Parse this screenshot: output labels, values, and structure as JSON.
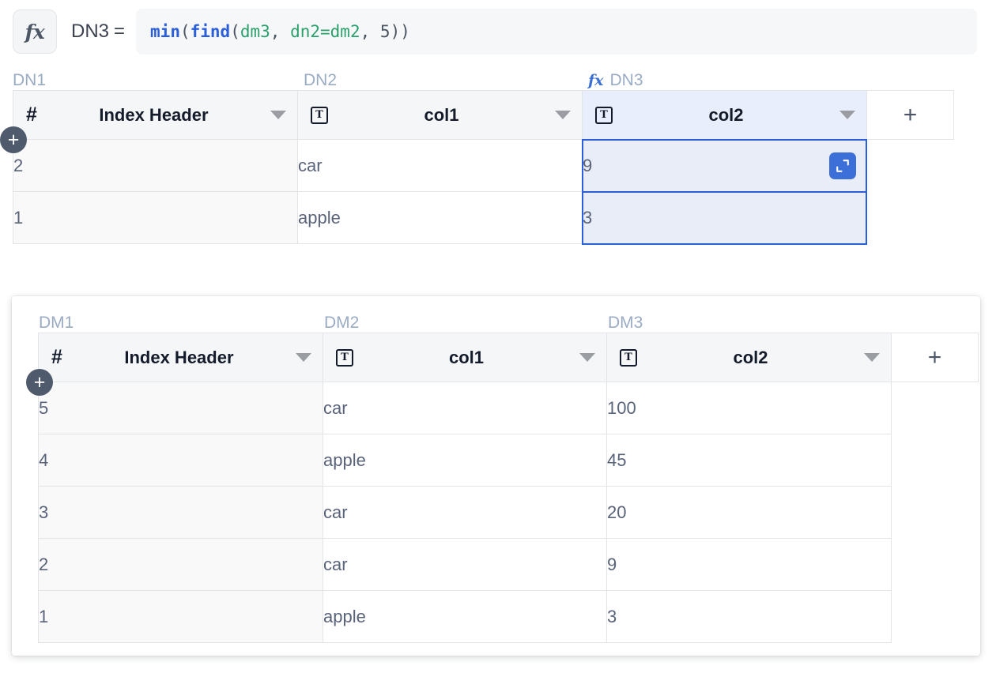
{
  "formula_bar": {
    "fx_icon": "fx-icon",
    "target_name": "DN3",
    "equals": "=",
    "formula_raw": "min(find(dm3, dn2=dm2, 5))",
    "tokens": [
      {
        "text": "min",
        "kind": "fn"
      },
      {
        "text": "(",
        "kind": "punct"
      },
      {
        "text": "find",
        "kind": "fn"
      },
      {
        "text": "(",
        "kind": "punct"
      },
      {
        "text": "dm3",
        "kind": "ref"
      },
      {
        "text": ", ",
        "kind": "punct"
      },
      {
        "text": "dn2=dm2",
        "kind": "ref"
      },
      {
        "text": ", ",
        "kind": "punct"
      },
      {
        "text": "5",
        "kind": "num"
      },
      {
        "text": "))",
        "kind": "punct"
      }
    ]
  },
  "top_grid": {
    "column_refs": [
      "DN1",
      "DN2",
      "DN3"
    ],
    "formula_column_ref": "DN3",
    "formula_column_icon": "fx-icon",
    "headers": [
      {
        "icon": "hash-icon",
        "icon_glyph": "#",
        "label": "Index Header",
        "caret": "chevron-down-icon"
      },
      {
        "icon": "text-type-icon",
        "icon_glyph": "T",
        "label": "col1",
        "caret": "chevron-down-icon"
      },
      {
        "icon": "text-type-icon",
        "icon_glyph": "T",
        "label": "col2",
        "caret": "chevron-down-icon"
      }
    ],
    "add_column_label": "+",
    "add_row_label": "+",
    "rows": [
      {
        "index": "2",
        "col1": "car",
        "col2": "9"
      },
      {
        "index": "1",
        "col1": "apple",
        "col2": "3"
      }
    ],
    "selected_cell": {
      "row": 0,
      "column": "col2",
      "value": "9"
    },
    "expand_icon": "expand-cell-icon"
  },
  "bottom_grid": {
    "column_refs": [
      "DM1",
      "DM2",
      "DM3"
    ],
    "headers": [
      {
        "icon": "hash-icon",
        "icon_glyph": "#",
        "label": "Index Header",
        "caret": "chevron-down-icon"
      },
      {
        "icon": "text-type-icon",
        "icon_glyph": "T",
        "label": "col1",
        "caret": "chevron-down-icon"
      },
      {
        "icon": "text-type-icon",
        "icon_glyph": "T",
        "label": "col2",
        "caret": "chevron-down-icon"
      }
    ],
    "add_column_label": "+",
    "add_row_label": "+",
    "rows": [
      {
        "index": "5",
        "col1": "car",
        "col2": "100"
      },
      {
        "index": "4",
        "col1": "apple",
        "col2": "45"
      },
      {
        "index": "3",
        "col1": "car",
        "col2": "20"
      },
      {
        "index": "2",
        "col1": "car",
        "col2": "9"
      },
      {
        "index": "1",
        "col1": "apple",
        "col2": "3"
      }
    ]
  },
  "colors": {
    "accent_blue": "#2b5fd9",
    "formula_fn": "#2b5fd9",
    "formula_ref": "#2aa06b",
    "ref_label": "#9aabc4",
    "header_bg": "#f5f6f8",
    "selection_bg": "#e8eefb",
    "text": "#59637a"
  }
}
